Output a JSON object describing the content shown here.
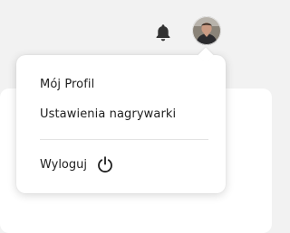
{
  "header": {
    "notification_icon": "bell-icon",
    "avatar_icon": "user-avatar"
  },
  "menu": {
    "items": [
      {
        "label": "Mój Profil"
      },
      {
        "label": "Ustawienia nagrywarki"
      }
    ],
    "logout": {
      "label": "Wyloguj",
      "icon": "power-icon"
    }
  },
  "colors": {
    "background": "#f2f2f2",
    "dropdown": "#ffffff",
    "text": "#1e1e1e",
    "icon": "#333333",
    "divider": "#e3e3e3"
  }
}
